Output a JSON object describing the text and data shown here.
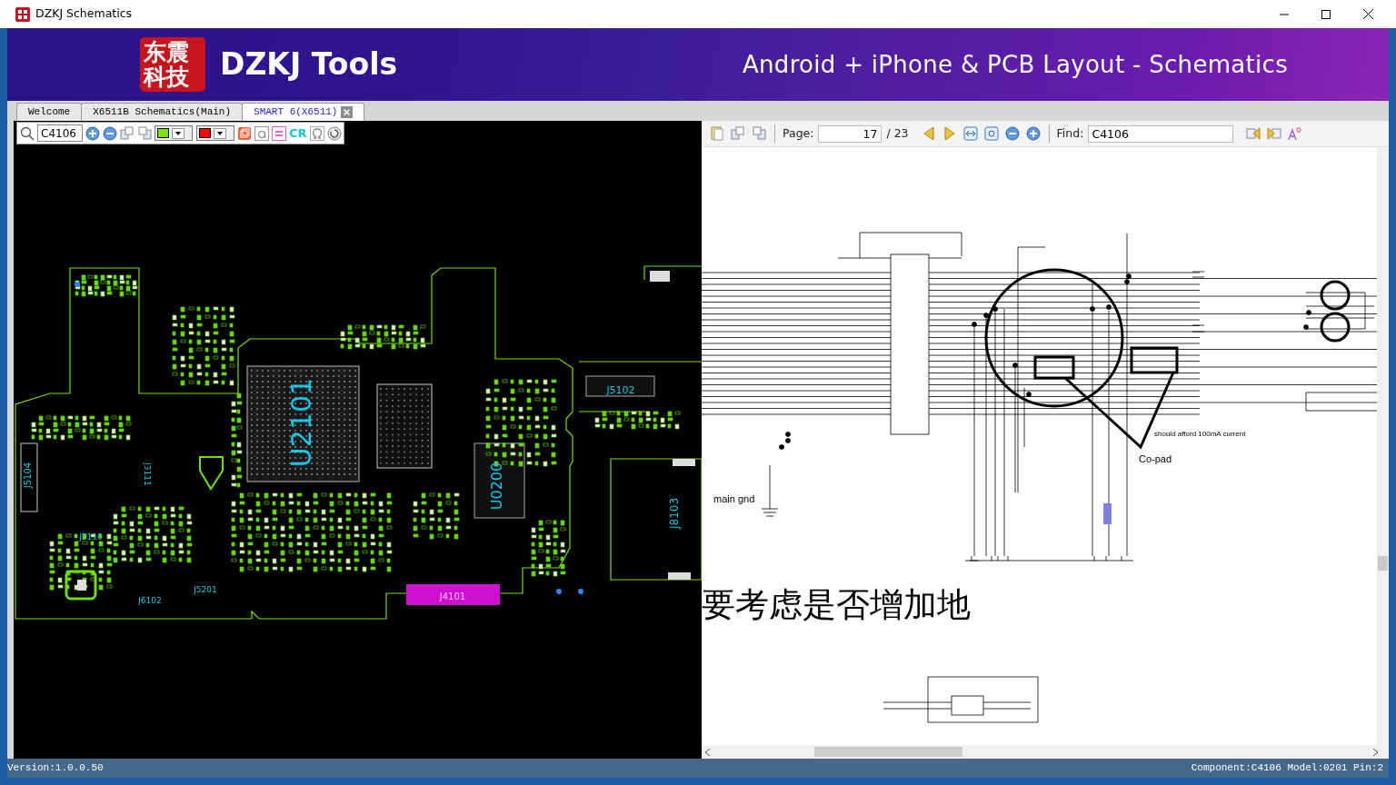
{
  "window": {
    "title": "DZKJ Schematics"
  },
  "banner": {
    "logo_text": "东震科技",
    "brand": "DZKJ Tools",
    "tagline": "Android + iPhone & PCB Layout - Schematics"
  },
  "tabs": [
    {
      "label": "Welcome",
      "selected": false,
      "closable": false
    },
    {
      "label": "X6511B Schematics(Main)",
      "selected": false,
      "closable": false
    },
    {
      "label": "SMART 6(X6511)",
      "selected": true,
      "closable": true
    }
  ],
  "pcb_toolbar": {
    "search_value": "C4106",
    "swatches": [
      {
        "color": "#80e000"
      },
      {
        "color": "#ff0000"
      }
    ],
    "cr_label": "CR"
  },
  "pcb": {
    "labels": [
      "U2101",
      "U0200",
      "J5102",
      "J8103",
      "J4101",
      "J5104",
      "J5110",
      "J5201",
      "J6102",
      "J3111"
    ]
  },
  "schematic_toolbar": {
    "page_label": "Page:",
    "page_value": "17",
    "page_total": "/ 23",
    "find_label": "Find:",
    "find_value": "C4106"
  },
  "schematic": {
    "labels": [
      "should afford 100mA current",
      "Co-pad",
      "main gnd",
      "要考虑是否增加地"
    ]
  },
  "status_bar": {
    "version": "Version:1.0.0.50",
    "component": "Component:C4106 Model:0201 Pin:2"
  }
}
